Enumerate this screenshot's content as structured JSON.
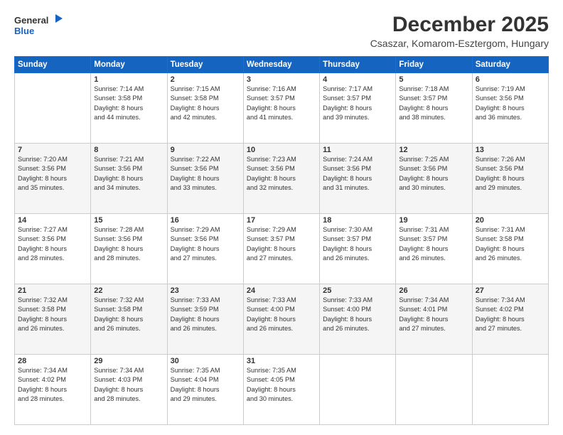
{
  "logo": {
    "line1": "General",
    "line2": "Blue"
  },
  "title": "December 2025",
  "subtitle": "Csaszar, Komarom-Esztergom, Hungary",
  "days_header": [
    "Sunday",
    "Monday",
    "Tuesday",
    "Wednesday",
    "Thursday",
    "Friday",
    "Saturday"
  ],
  "weeks": [
    {
      "alt": false,
      "days": [
        {
          "num": "",
          "info": ""
        },
        {
          "num": "1",
          "info": "Sunrise: 7:14 AM\nSunset: 3:58 PM\nDaylight: 8 hours\nand 44 minutes."
        },
        {
          "num": "2",
          "info": "Sunrise: 7:15 AM\nSunset: 3:58 PM\nDaylight: 8 hours\nand 42 minutes."
        },
        {
          "num": "3",
          "info": "Sunrise: 7:16 AM\nSunset: 3:57 PM\nDaylight: 8 hours\nand 41 minutes."
        },
        {
          "num": "4",
          "info": "Sunrise: 7:17 AM\nSunset: 3:57 PM\nDaylight: 8 hours\nand 39 minutes."
        },
        {
          "num": "5",
          "info": "Sunrise: 7:18 AM\nSunset: 3:57 PM\nDaylight: 8 hours\nand 38 minutes."
        },
        {
          "num": "6",
          "info": "Sunrise: 7:19 AM\nSunset: 3:56 PM\nDaylight: 8 hours\nand 36 minutes."
        }
      ]
    },
    {
      "alt": true,
      "days": [
        {
          "num": "7",
          "info": "Sunrise: 7:20 AM\nSunset: 3:56 PM\nDaylight: 8 hours\nand 35 minutes."
        },
        {
          "num": "8",
          "info": "Sunrise: 7:21 AM\nSunset: 3:56 PM\nDaylight: 8 hours\nand 34 minutes."
        },
        {
          "num": "9",
          "info": "Sunrise: 7:22 AM\nSunset: 3:56 PM\nDaylight: 8 hours\nand 33 minutes."
        },
        {
          "num": "10",
          "info": "Sunrise: 7:23 AM\nSunset: 3:56 PM\nDaylight: 8 hours\nand 32 minutes."
        },
        {
          "num": "11",
          "info": "Sunrise: 7:24 AM\nSunset: 3:56 PM\nDaylight: 8 hours\nand 31 minutes."
        },
        {
          "num": "12",
          "info": "Sunrise: 7:25 AM\nSunset: 3:56 PM\nDaylight: 8 hours\nand 30 minutes."
        },
        {
          "num": "13",
          "info": "Sunrise: 7:26 AM\nSunset: 3:56 PM\nDaylight: 8 hours\nand 29 minutes."
        }
      ]
    },
    {
      "alt": false,
      "days": [
        {
          "num": "14",
          "info": "Sunrise: 7:27 AM\nSunset: 3:56 PM\nDaylight: 8 hours\nand 28 minutes."
        },
        {
          "num": "15",
          "info": "Sunrise: 7:28 AM\nSunset: 3:56 PM\nDaylight: 8 hours\nand 28 minutes."
        },
        {
          "num": "16",
          "info": "Sunrise: 7:29 AM\nSunset: 3:56 PM\nDaylight: 8 hours\nand 27 minutes."
        },
        {
          "num": "17",
          "info": "Sunrise: 7:29 AM\nSunset: 3:57 PM\nDaylight: 8 hours\nand 27 minutes."
        },
        {
          "num": "18",
          "info": "Sunrise: 7:30 AM\nSunset: 3:57 PM\nDaylight: 8 hours\nand 26 minutes."
        },
        {
          "num": "19",
          "info": "Sunrise: 7:31 AM\nSunset: 3:57 PM\nDaylight: 8 hours\nand 26 minutes."
        },
        {
          "num": "20",
          "info": "Sunrise: 7:31 AM\nSunset: 3:58 PM\nDaylight: 8 hours\nand 26 minutes."
        }
      ]
    },
    {
      "alt": true,
      "days": [
        {
          "num": "21",
          "info": "Sunrise: 7:32 AM\nSunset: 3:58 PM\nDaylight: 8 hours\nand 26 minutes."
        },
        {
          "num": "22",
          "info": "Sunrise: 7:32 AM\nSunset: 3:58 PM\nDaylight: 8 hours\nand 26 minutes."
        },
        {
          "num": "23",
          "info": "Sunrise: 7:33 AM\nSunset: 3:59 PM\nDaylight: 8 hours\nand 26 minutes."
        },
        {
          "num": "24",
          "info": "Sunrise: 7:33 AM\nSunset: 4:00 PM\nDaylight: 8 hours\nand 26 minutes."
        },
        {
          "num": "25",
          "info": "Sunrise: 7:33 AM\nSunset: 4:00 PM\nDaylight: 8 hours\nand 26 minutes."
        },
        {
          "num": "26",
          "info": "Sunrise: 7:34 AM\nSunset: 4:01 PM\nDaylight: 8 hours\nand 27 minutes."
        },
        {
          "num": "27",
          "info": "Sunrise: 7:34 AM\nSunset: 4:02 PM\nDaylight: 8 hours\nand 27 minutes."
        }
      ]
    },
    {
      "alt": false,
      "days": [
        {
          "num": "28",
          "info": "Sunrise: 7:34 AM\nSunset: 4:02 PM\nDaylight: 8 hours\nand 28 minutes."
        },
        {
          "num": "29",
          "info": "Sunrise: 7:34 AM\nSunset: 4:03 PM\nDaylight: 8 hours\nand 28 minutes."
        },
        {
          "num": "30",
          "info": "Sunrise: 7:35 AM\nSunset: 4:04 PM\nDaylight: 8 hours\nand 29 minutes."
        },
        {
          "num": "31",
          "info": "Sunrise: 7:35 AM\nSunset: 4:05 PM\nDaylight: 8 hours\nand 30 minutes."
        },
        {
          "num": "",
          "info": ""
        },
        {
          "num": "",
          "info": ""
        },
        {
          "num": "",
          "info": ""
        }
      ]
    }
  ]
}
